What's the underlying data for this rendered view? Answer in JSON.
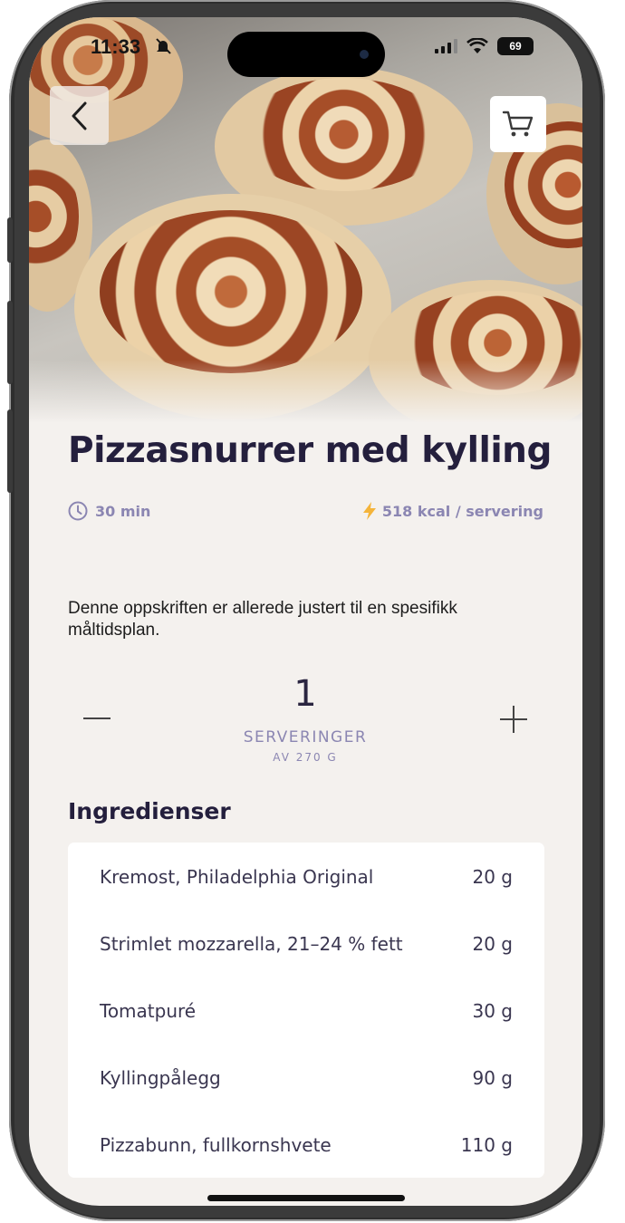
{
  "status_bar": {
    "time": "11:33",
    "battery": "69"
  },
  "hero": {
    "image_description_icon": "pizza-rolls-photo"
  },
  "buttons": {
    "back_icon": "chevron-left-icon",
    "cart_icon": "shopping-cart-icon"
  },
  "recipe": {
    "title": "Pizzasnurrer med kylling",
    "time": "30 min",
    "kcal": "518 kcal / servering",
    "note": "Denne oppskriften er allerede justert til en spesifikk måltidsplan."
  },
  "servings": {
    "count": "1",
    "label": "SERVERINGER",
    "sub": "AV 270 G"
  },
  "ingredients": {
    "heading": "Ingredienser",
    "items": [
      {
        "name": "Kremost, Philadelphia Original",
        "amount": "20 g"
      },
      {
        "name": "Strimlet mozzarella, 21–24 % fett",
        "amount": "20 g"
      },
      {
        "name": "Tomatpuré",
        "amount": "30 g"
      },
      {
        "name": "Kyllingpålegg",
        "amount": "90 g"
      },
      {
        "name": "Pizzabunn, fullkornshvete",
        "amount": "110 g"
      }
    ]
  },
  "colors": {
    "accent_text": "#8b86b2",
    "title": "#241f3d",
    "background": "#f4f1ee",
    "bolt": "#f4b43a"
  }
}
